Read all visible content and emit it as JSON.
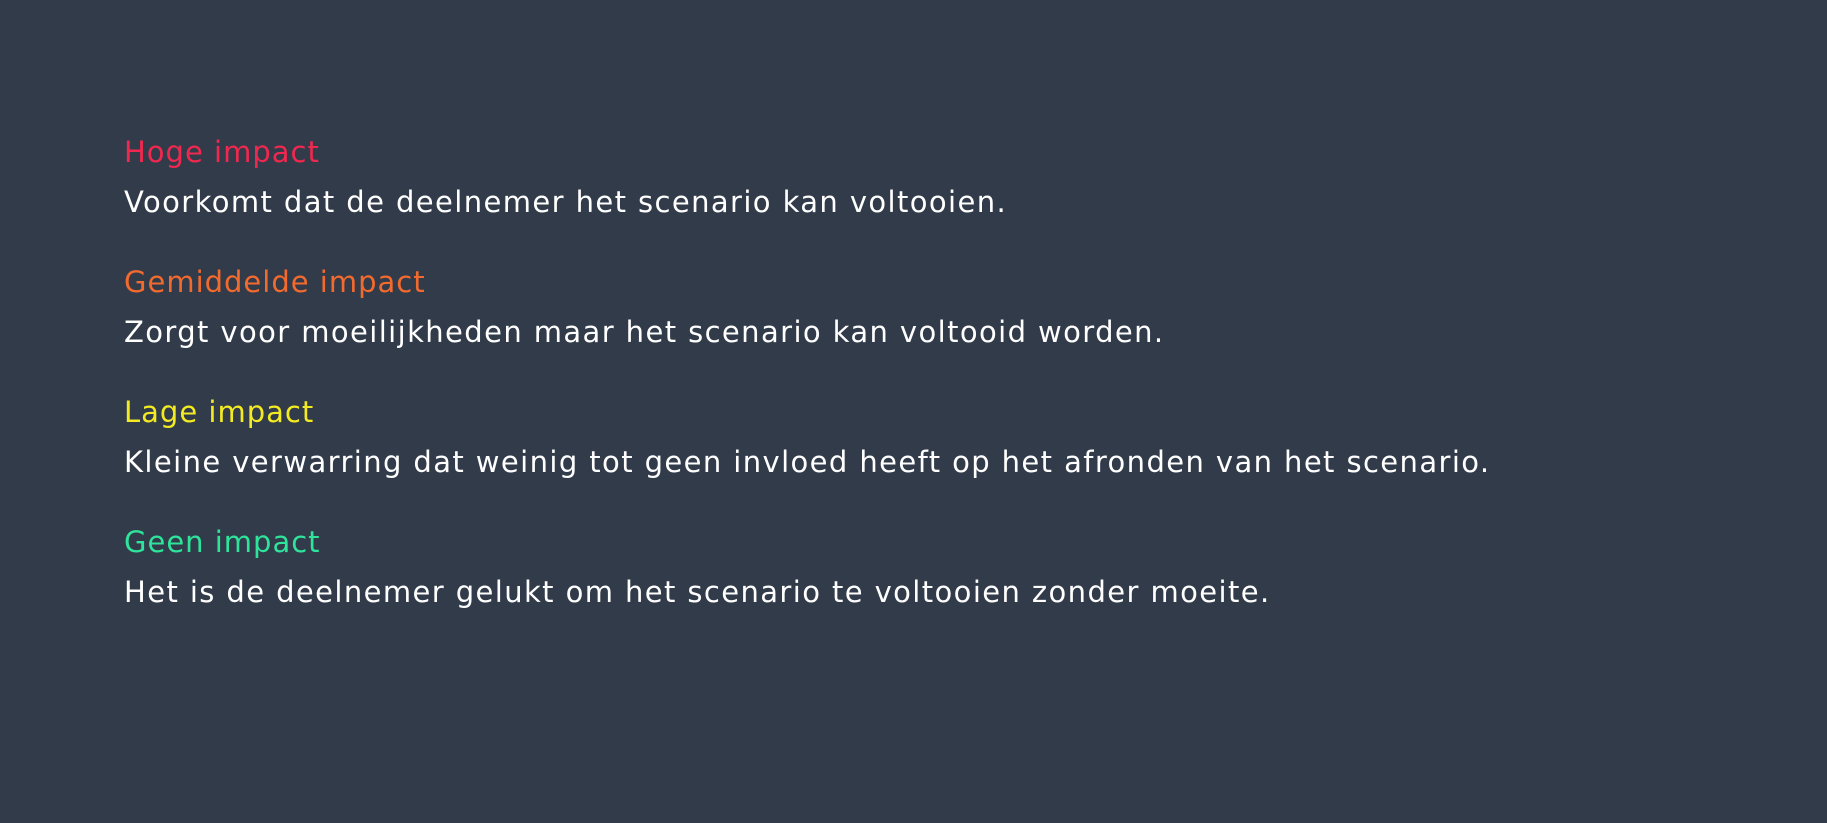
{
  "impact_levels": [
    {
      "title": "Hoge impact",
      "description": "Voorkomt dat de deelnemer het scenario kan voltooien.",
      "color": "#f0284f"
    },
    {
      "title": "Gemiddelde impact",
      "description": "Zorgt voor moeilijkheden maar het scenario kan voltooid worden.",
      "color": "#f26a2e"
    },
    {
      "title": "Lage impact",
      "description": "Kleine verwarring dat weinig tot geen invloed heeft op het afronden van het scenario.",
      "color": "#f3ea22"
    },
    {
      "title": "Geen impact",
      "description": "Het is de deelnemer gelukt om het scenario te voltooien zonder moeite.",
      "color": "#2ee39a"
    }
  ]
}
